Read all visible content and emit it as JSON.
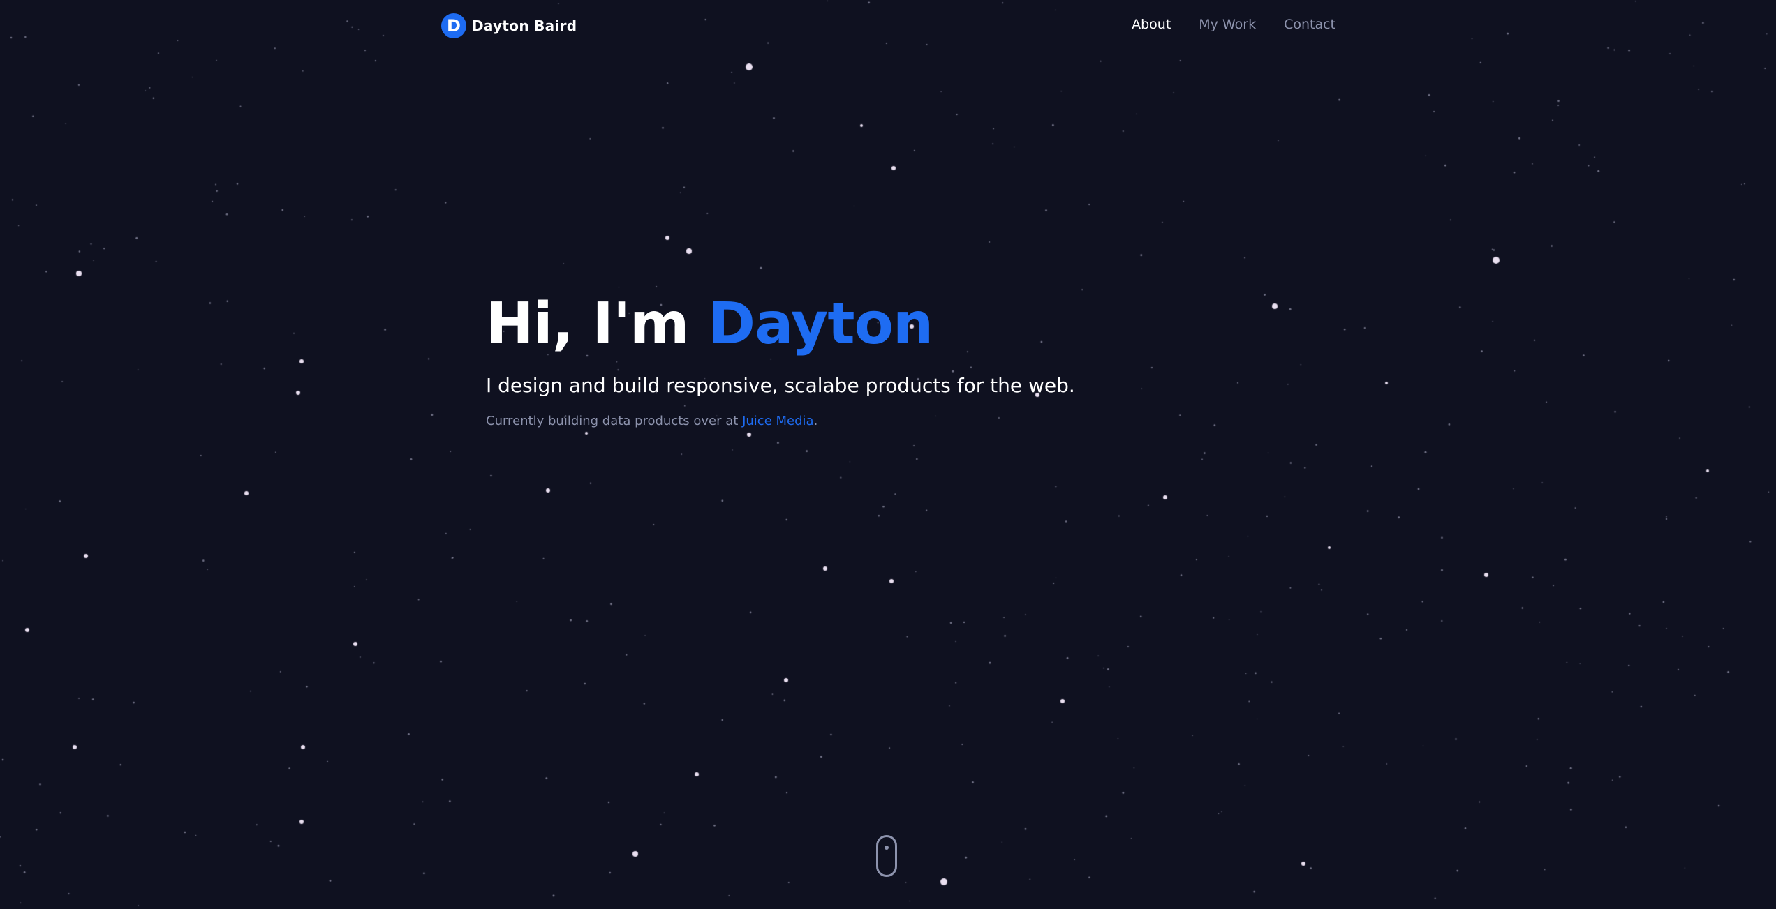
{
  "brand": {
    "logo_letter": "D",
    "name": "Dayton Baird"
  },
  "nav": {
    "items": [
      {
        "label": "About",
        "active": true
      },
      {
        "label": "My Work",
        "active": false
      },
      {
        "label": "Contact",
        "active": false
      }
    ]
  },
  "hero": {
    "greeting": "Hi, I'm ",
    "name": "Dayton",
    "tagline": "I design and build responsive, scalabe products for the web.",
    "current_prefix": "Currently building data products over at ",
    "current_company": "Juice Media",
    "current_suffix": "."
  },
  "colors": {
    "background": "#0f1120",
    "accent": "#1e6cf2",
    "muted_text": "#8d93ad",
    "star": "#e9dff0"
  },
  "icons": {
    "scroll": "mouse-scroll-icon"
  }
}
